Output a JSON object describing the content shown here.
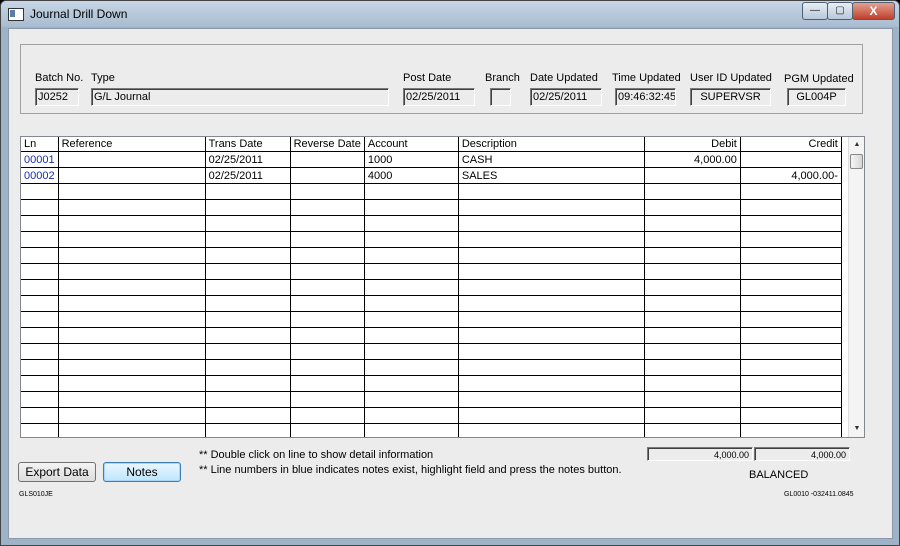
{
  "window": {
    "title": "Journal Drill Down",
    "buttons": {
      "minimize": "—",
      "maximize": "▢",
      "close": "X"
    }
  },
  "header": {
    "batch_no": {
      "label": "Batch No.",
      "value": "J0252"
    },
    "type": {
      "label": "Type",
      "value": "G/L Journal"
    },
    "post_date": {
      "label": "Post Date",
      "value": "02/25/2011"
    },
    "branch": {
      "label": "Branch",
      "value": ""
    },
    "date_updated": {
      "label": "Date Updated",
      "value": "02/25/2011"
    },
    "time_updated": {
      "label": "Time Updated",
      "value": "09:46:32:45"
    },
    "user_id_updated": {
      "label": "User ID Updated",
      "value": "SUPERVSR"
    },
    "pgm_updated": {
      "label": "PGM Updated",
      "value": "GL004P"
    }
  },
  "grid": {
    "columns": [
      "Ln",
      "Reference",
      "Trans Date",
      "Reverse Date",
      "Account",
      "Description",
      "Debit",
      "Credit"
    ],
    "rows": [
      {
        "ln": "00001",
        "reference": "",
        "trans_date": "02/25/2011",
        "reverse_date": "",
        "account": "1000",
        "description": "CASH",
        "debit": "4,000.00",
        "credit": ""
      },
      {
        "ln": "00002",
        "reference": "",
        "trans_date": "02/25/2011",
        "reverse_date": "",
        "account": "4000",
        "description": "SALES",
        "debit": "",
        "credit": "4,000.00-"
      }
    ]
  },
  "buttons": {
    "export": "Export Data",
    "notes": "Notes"
  },
  "notes": {
    "line1": "**  Double click on line to show detail information",
    "line2": "**  Line numbers in blue indicates notes exist, highlight field and press the notes button."
  },
  "totals": {
    "debit": "4,000.00",
    "credit": "4,000.00",
    "status": "BALANCED"
  },
  "footer": {
    "form_id": "GLS010JE",
    "code": "GL0010 -032411.0845"
  }
}
